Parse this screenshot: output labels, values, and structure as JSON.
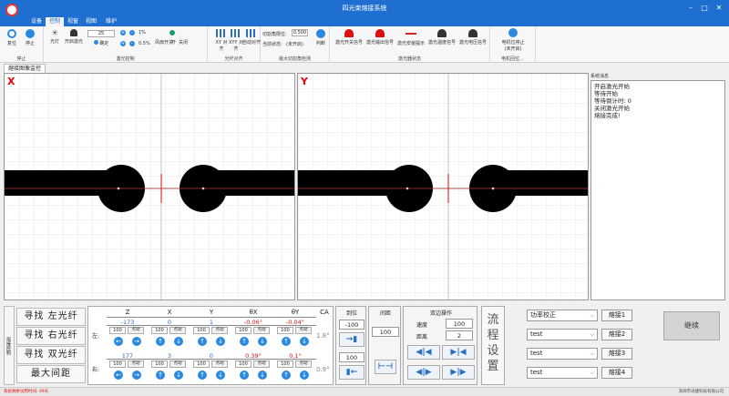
{
  "window": {
    "title": "四光束熔接系统"
  },
  "menu": [
    "设备",
    "控制",
    "视窗",
    "视图",
    "维护"
  ],
  "ribbon": {
    "system": {
      "reset": "复位",
      "stop": "停止",
      "group_label": "停止"
    },
    "laser": {
      "light": "光灯",
      "open_laser": "开启激光",
      "power_value": "25",
      "confirm": "确定",
      "pct_a": "1%",
      "pct_b": "0.5%",
      "fan_label": "风扇开关",
      "fan_on": "开",
      "fan_off": "关闭",
      "group_label": "激光控制"
    },
    "fiber": {
      "xy": "XY 对齐",
      "xyy": "XYY 对齐",
      "auto": "自动对齐",
      "group_label": "光纤对齐"
    },
    "cut": {
      "cut_limit_label": "切割角限位:",
      "cut_limit_value": "0.500",
      "status_label": "当前状态:",
      "status_value": "(未开启)",
      "judge": "判断",
      "group_label": "最大切割角检测"
    },
    "laser_state": {
      "items": [
        "激光开关信号",
        "激光输出信号",
        "激光安装提示",
        "激光温度信号",
        "激光电压信号"
      ],
      "group_label": "激光器状态"
    },
    "motor": {
      "stop_label": "电机位停止",
      "stop_sub": "(未开启)",
      "group_label": "电机回位..."
    }
  },
  "tab": "熔接图像监控",
  "cameras": [
    {
      "label": "X"
    },
    {
      "label": "Y"
    }
  ],
  "messages": {
    "title": "系统消息",
    "lines": [
      "开启激光开始",
      "等待开始",
      "等待倒计时: 0",
      "关闭激光开始",
      "熔接完成!"
    ]
  },
  "control": {
    "side_label": "熔接控制",
    "find_buttons": [
      "寻找 左光纤",
      "寻找 右光纤",
      "寻找 双光纤",
      "最大间距"
    ],
    "axes": {
      "headers": [
        "Z",
        "X",
        "Y",
        "θX",
        "θY",
        "CA"
      ],
      "left_label": "左:",
      "right_label": "右:",
      "left_values": [
        "-173",
        "0",
        "1",
        "-0.06°",
        "-0.04°"
      ],
      "right_values": [
        "177",
        "3",
        "0",
        "0.39°",
        "0.1°"
      ],
      "ca_left": "1.8°",
      "ca_right": "0.9°",
      "step": "100",
      "step_btn": "点动"
    },
    "position": {
      "header": "到位",
      "value_top": "-100",
      "value_bottom": "100"
    },
    "gap": {
      "header": "间距",
      "value": "100"
    },
    "double": {
      "header": "双边操作",
      "speed_label": "速度",
      "speed": "100",
      "dist_label": "距离",
      "dist": "2"
    },
    "flow": "流程设置",
    "process": [
      {
        "option": "功率校正",
        "button": "熔接1"
      },
      {
        "option": "test",
        "button": "熔接2"
      },
      {
        "option": "test",
        "button": "熔接3"
      },
      {
        "option": "test",
        "button": "熔接4"
      }
    ],
    "continue": "继续"
  },
  "status": {
    "left": "系统剩余试用时间: 49天",
    "right": "深圳市讯捷科技有限公司"
  }
}
